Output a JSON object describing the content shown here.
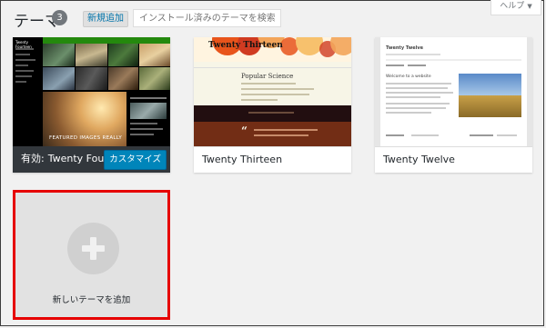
{
  "header": {
    "title": "テーマ",
    "theme_count": "3",
    "add_new_label": "新規追加",
    "search_placeholder": "インストール済みのテーマを検索...",
    "help_label": "ヘルプ"
  },
  "themes": [
    {
      "name": "Twenty Fourteen",
      "active_prefix": "有効:",
      "customize_label": "カスタマイズ",
      "preview": {
        "site_title": "Twenty Fourteen",
        "featured": "FEATURED IMAGES REALLY"
      }
    },
    {
      "name": "Twenty Thirteen",
      "preview": {
        "site_title": "Twenty Thirteen",
        "post_title": "Popular Science"
      }
    },
    {
      "name": "Twenty Twelve",
      "preview": {
        "site_title": "Twenty Twelve",
        "welcome": "Welcome to a website"
      }
    }
  ],
  "add_new_theme_label": "新しいテーマを追加",
  "colors": {
    "accent_blue": "#0085ba",
    "active_caption_bg": "#32373c",
    "highlight_red": "#e60000",
    "tf_green": "#24890d",
    "tt_brown": "#722d15"
  },
  "icons": {
    "help_dropdown": "triangle-down",
    "add_theme": "plus"
  }
}
